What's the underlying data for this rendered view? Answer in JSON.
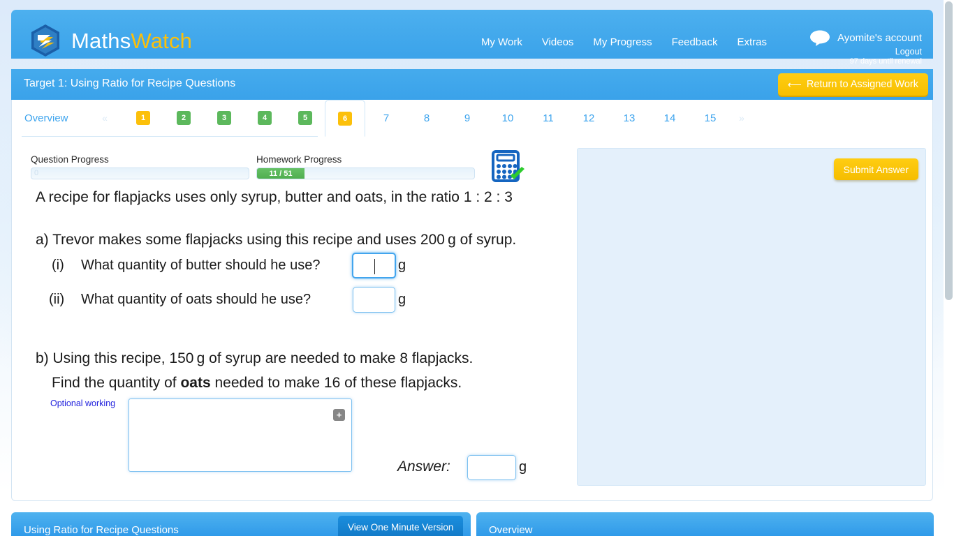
{
  "brand": {
    "name_part1": "Maths",
    "name_part2": "Watch",
    "logo_icon": "mathswatch-hexagon-logo",
    "color_blue": "#43a9ec",
    "color_yellow": "#fcc00a"
  },
  "header": {
    "nav": [
      {
        "label": "My Work"
      },
      {
        "label": "Videos"
      },
      {
        "label": "My Progress"
      },
      {
        "label": "Feedback"
      },
      {
        "label": "Extras"
      }
    ],
    "account": {
      "avatar_icon": "speech-bubble-icon",
      "name": "Ayomite's account",
      "logout": "Logout",
      "renewal": "97 days until renewal"
    }
  },
  "target_bar": {
    "title": "Target 1: Using Ratio for Recipe Questions",
    "return_button": {
      "label": "Return to Assigned Work",
      "icon": "arrow-left-icon"
    }
  },
  "tabs": {
    "overview_label": "Overview",
    "prev_icon": "«",
    "next_icon": "»",
    "items": [
      {
        "label": "1",
        "state": "yellow",
        "active": false
      },
      {
        "label": "2",
        "state": "green",
        "active": false
      },
      {
        "label": "3",
        "state": "green",
        "active": false
      },
      {
        "label": "4",
        "state": "green",
        "active": false
      },
      {
        "label": "5",
        "state": "green",
        "active": false
      },
      {
        "label": "6",
        "state": "yellow",
        "active": true
      },
      {
        "label": "7",
        "state": "plain",
        "active": false
      },
      {
        "label": "8",
        "state": "plain",
        "active": false
      },
      {
        "label": "9",
        "state": "plain",
        "active": false
      },
      {
        "label": "10",
        "state": "plain",
        "active": false
      },
      {
        "label": "11",
        "state": "plain",
        "active": false
      },
      {
        "label": "12",
        "state": "plain",
        "active": false
      },
      {
        "label": "13",
        "state": "plain",
        "active": false
      },
      {
        "label": "14",
        "state": "plain",
        "active": false
      },
      {
        "label": "15",
        "state": "plain",
        "active": false
      }
    ]
  },
  "progress": {
    "question": {
      "label": "Question Progress",
      "value_text": "0",
      "percent": 0
    },
    "homework": {
      "label": "Homework Progress",
      "value_text": "11 / 51",
      "percent": 21.6
    },
    "calculator_icon": "calculator-allowed-icon"
  },
  "question": {
    "stem": "A recipe for flapjacks uses only syrup, butter and oats, in the ratio 1 : 2 : 3",
    "part_a": "a) Trevor makes some flapjacks using this recipe and uses 200 g of syrup.",
    "part_a_i_label": "(i)",
    "part_a_i_text": "What quantity of butter should he use?",
    "part_a_i_value": "",
    "part_a_i_unit": "g",
    "part_a_ii_label": "(ii)",
    "part_a_ii_text": "What quantity of oats should he use?",
    "part_a_ii_value": "",
    "part_a_ii_unit": "g",
    "part_b_line1": "b) Using this recipe, 150 g of syrup are needed to make 8 flapjacks.",
    "part_b_line2_pre": "Find the quantity of ",
    "part_b_line2_bold": "oats",
    "part_b_line2_post": " needed to make 16 of these flapjacks.",
    "optional_working_label": "Optional working",
    "working_value": "",
    "expand_icon": "plus-icon",
    "answer_label": "Answer:",
    "answer_value": "",
    "answer_unit": "g"
  },
  "right_panel": {
    "submit_label": "Submit Answer"
  },
  "bottom_panels": {
    "left_title": "Using Ratio for Recipe Questions",
    "one_minute_button": "View One Minute Version",
    "right_title": "Overview"
  }
}
